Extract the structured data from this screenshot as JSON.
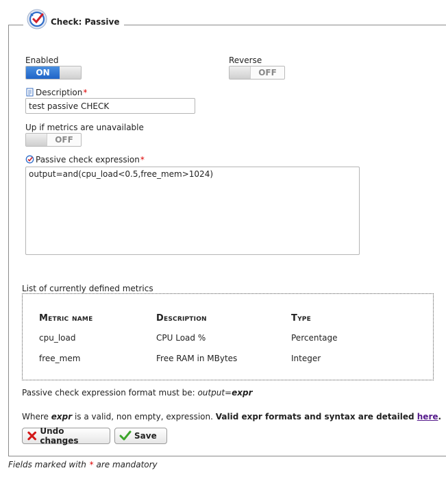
{
  "panel": {
    "title": "Check: Passive"
  },
  "enabled": {
    "label": "Enabled",
    "state": "ON"
  },
  "reverse": {
    "label": "Reverse",
    "state": "OFF"
  },
  "description": {
    "label": "Description",
    "required": "*",
    "value": "test passive CHECK"
  },
  "up_if_unavailable": {
    "label": "Up if metrics are unavailable",
    "state": "OFF"
  },
  "expression": {
    "label": "Passive check expression",
    "required": "*",
    "value": "output=and(cpu_load<0.5,free_mem>1024)"
  },
  "metrics": {
    "title": "List of currently defined metrics",
    "headers": [
      "Metric name",
      "Description",
      "Type"
    ],
    "rows": [
      [
        "cpu_load",
        "CPU Load %",
        "Percentage"
      ],
      [
        "free_mem",
        "Free RAM in MBytes",
        "Integer"
      ]
    ]
  },
  "format_note": {
    "prefix": "Passive check expression format must be: ",
    "format": "output=",
    "expr": "expr"
  },
  "where_note": {
    "where": "Where ",
    "expr": "expr",
    "middle": " is a valid, non empty, expression. ",
    "bold_text": "Valid expr formats and syntax are detailed ",
    "link": "here",
    "end": "."
  },
  "buttons": {
    "undo": "Undo changes",
    "save": "Save"
  },
  "footer": {
    "prefix": "Fields marked with ",
    "star": "*",
    "suffix": " are mandatory"
  },
  "colors": {
    "accent": "#1f64c8",
    "required": "#dd0000",
    "link": "#551a8b"
  }
}
